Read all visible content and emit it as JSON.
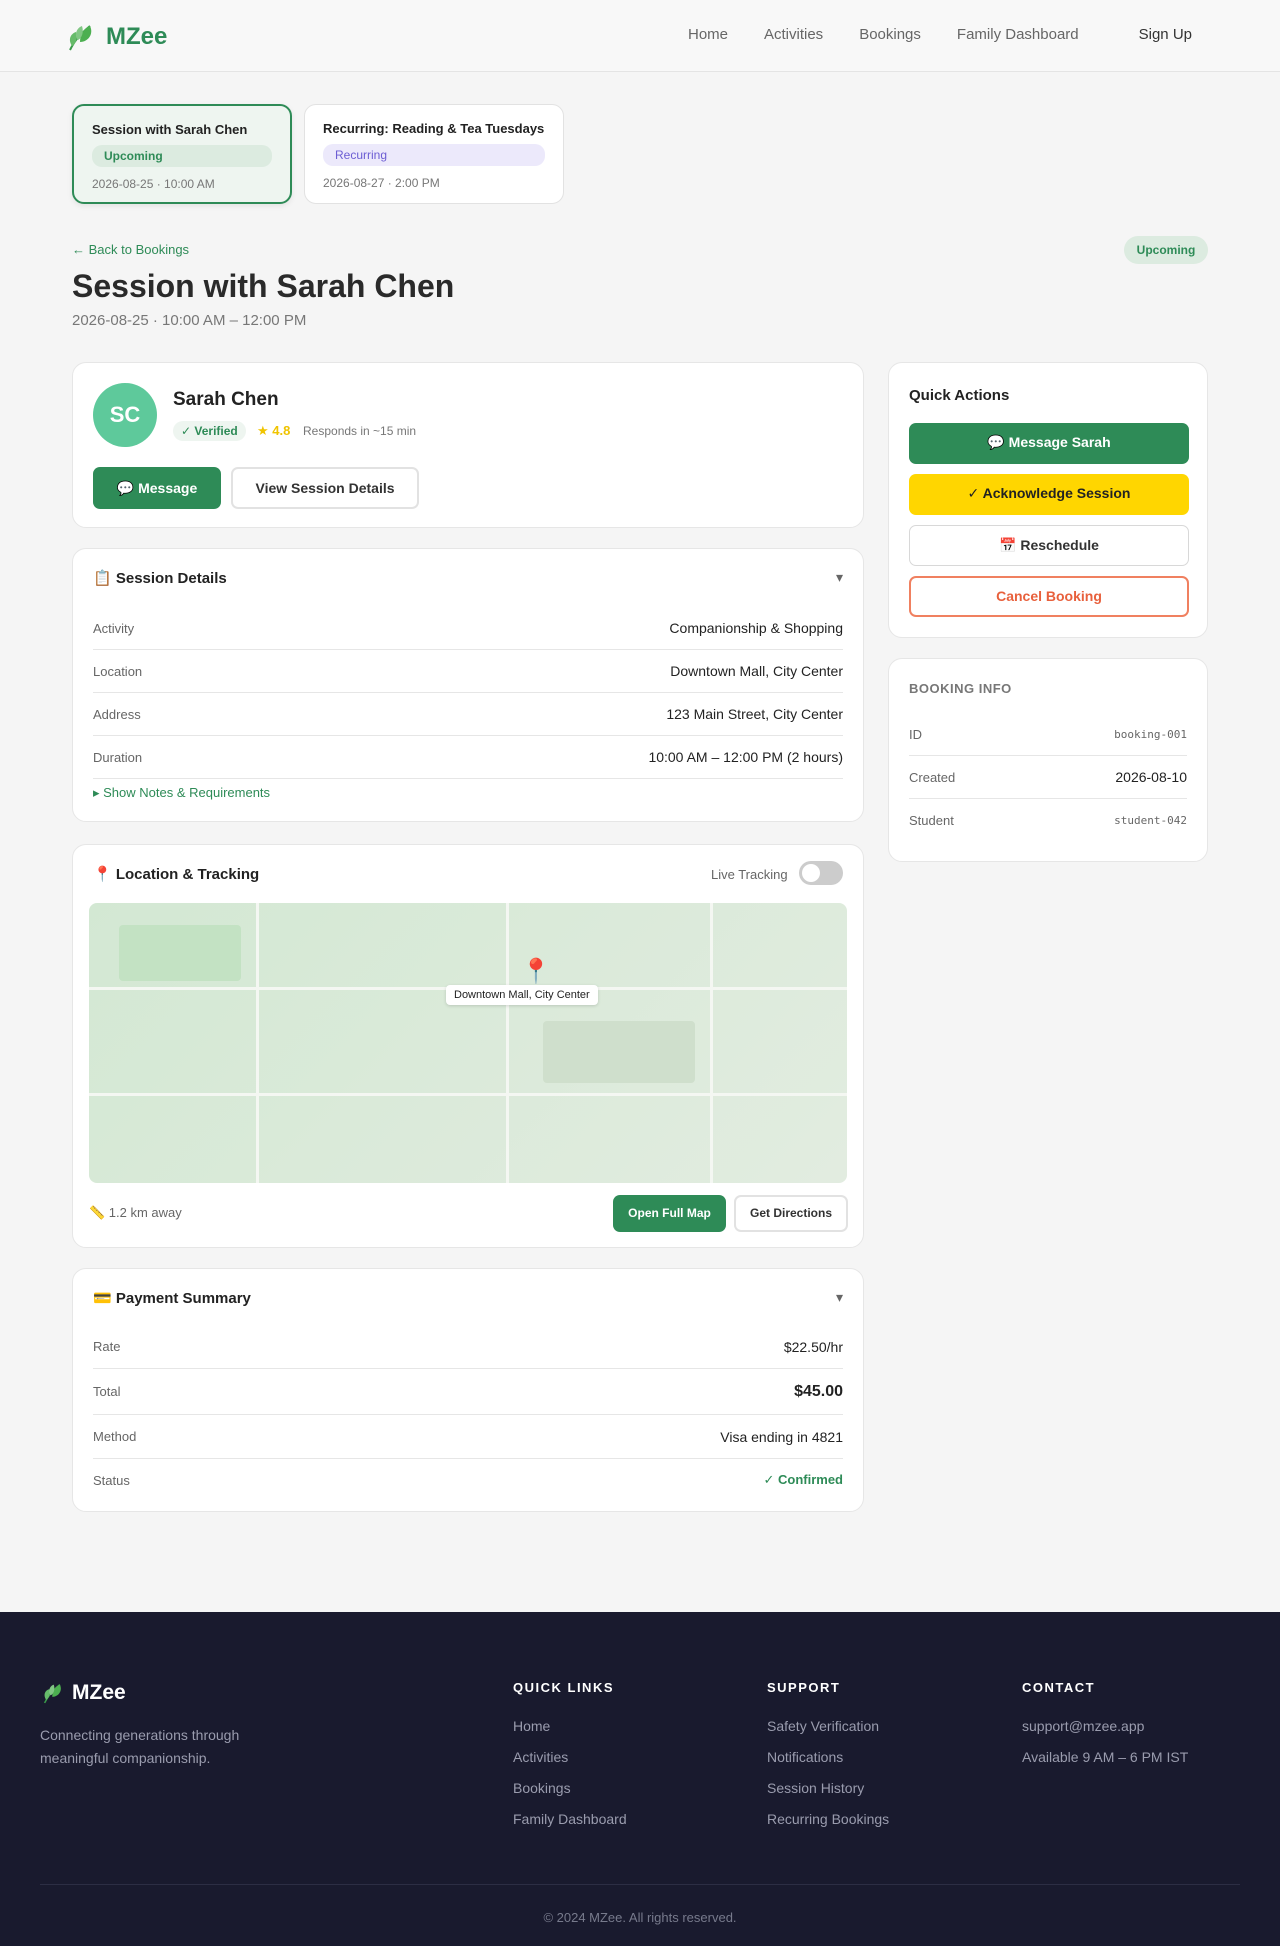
{
  "nav": {
    "brand": "MZee",
    "links": [
      "Home",
      "Activities",
      "Bookings",
      "Family Dashboard"
    ],
    "signup": "Sign Up"
  },
  "session_tabs": [
    {
      "title": "Session with Sarah Chen",
      "badge": "Upcoming",
      "date": "2026-08-25 · 10:00 AM"
    },
    {
      "title": "Recurring: Reading & Tea Tuesdays",
      "badge": "Recurring",
      "date": "2026-08-27 · 2:00 PM"
    }
  ],
  "page": {
    "back": "← Back to Bookings",
    "status": "Upcoming",
    "title": "Session with Sarah Chen",
    "subtitle": "2026-08-25 · 10:00 AM – 12:00 PM"
  },
  "companion": {
    "initials": "SC",
    "name": "Sarah Chen",
    "verified": "✓ Verified",
    "rating": "★ 4.8",
    "responds": "Responds in ~15 min",
    "message_btn": "💬 Message",
    "details_btn": "View Session Details"
  },
  "session_details": {
    "title": "📋 Session Details",
    "toggle": "▾",
    "rows": [
      {
        "label": "Activity",
        "value": "Companionship & Shopping"
      },
      {
        "label": "Location",
        "value": "Downtown Mall, City Center"
      },
      {
        "label": "Address",
        "value": "123 Main Street, City Center"
      },
      {
        "label": "Duration",
        "value": "10:00 AM – 12:00 PM (2 hours)"
      }
    ],
    "notes_link": "▸ Show Notes & Requirements"
  },
  "location": {
    "title": "📍 Location & Tracking",
    "live_tracking": "Live Tracking",
    "live_tracking_on": false,
    "pin_label": "Downtown Mall, City Center",
    "pin_icon": "📍",
    "distance": "📏 1.2 km away",
    "open_map": "Open Full Map",
    "directions": "Get Directions"
  },
  "payment": {
    "title": "💳 Payment Summary",
    "toggle": "▾",
    "rows": [
      {
        "label": "Rate",
        "value": "$22.50/hr"
      },
      {
        "label": "Total",
        "value": "$45.00"
      },
      {
        "label": "Method",
        "value": "Visa ending in 4821"
      },
      {
        "label": "Status",
        "value": "✓ Confirmed"
      }
    ]
  },
  "quick_actions": {
    "title": "Quick Actions",
    "message": "💬 Message Sarah",
    "acknowledge": "✓ Acknowledge Session",
    "reschedule": "📅 Reschedule",
    "cancel": "Cancel Booking"
  },
  "booking_info": {
    "title": "BOOKING INFO",
    "rows": [
      {
        "label": "ID",
        "value": "booking-001"
      },
      {
        "label": "Created",
        "value": "2026-08-10"
      },
      {
        "label": "Student",
        "value": "student-042"
      }
    ]
  },
  "footer": {
    "brand": "MZee",
    "tagline": "Connecting generations through meaningful companionship.",
    "quick_links": {
      "title": "QUICK LINKS",
      "items": [
        "Home",
        "Activities",
        "Bookings",
        "Family Dashboard"
      ]
    },
    "support": {
      "title": "SUPPORT",
      "items": [
        "Safety Verification",
        "Notifications",
        "Session History",
        "Recurring Bookings"
      ]
    },
    "contact": {
      "title": "CONTACT",
      "items": [
        "support@mzee.app",
        "Available 9 AM – 6 PM IST"
      ]
    },
    "copyright": "© 2024 MZee. All rights reserved."
  },
  "colors": {
    "brand": "#2e8b57",
    "accent_yellow": "#ffd600",
    "danger": "#e8603c",
    "footer_bg": "#191a2e"
  }
}
